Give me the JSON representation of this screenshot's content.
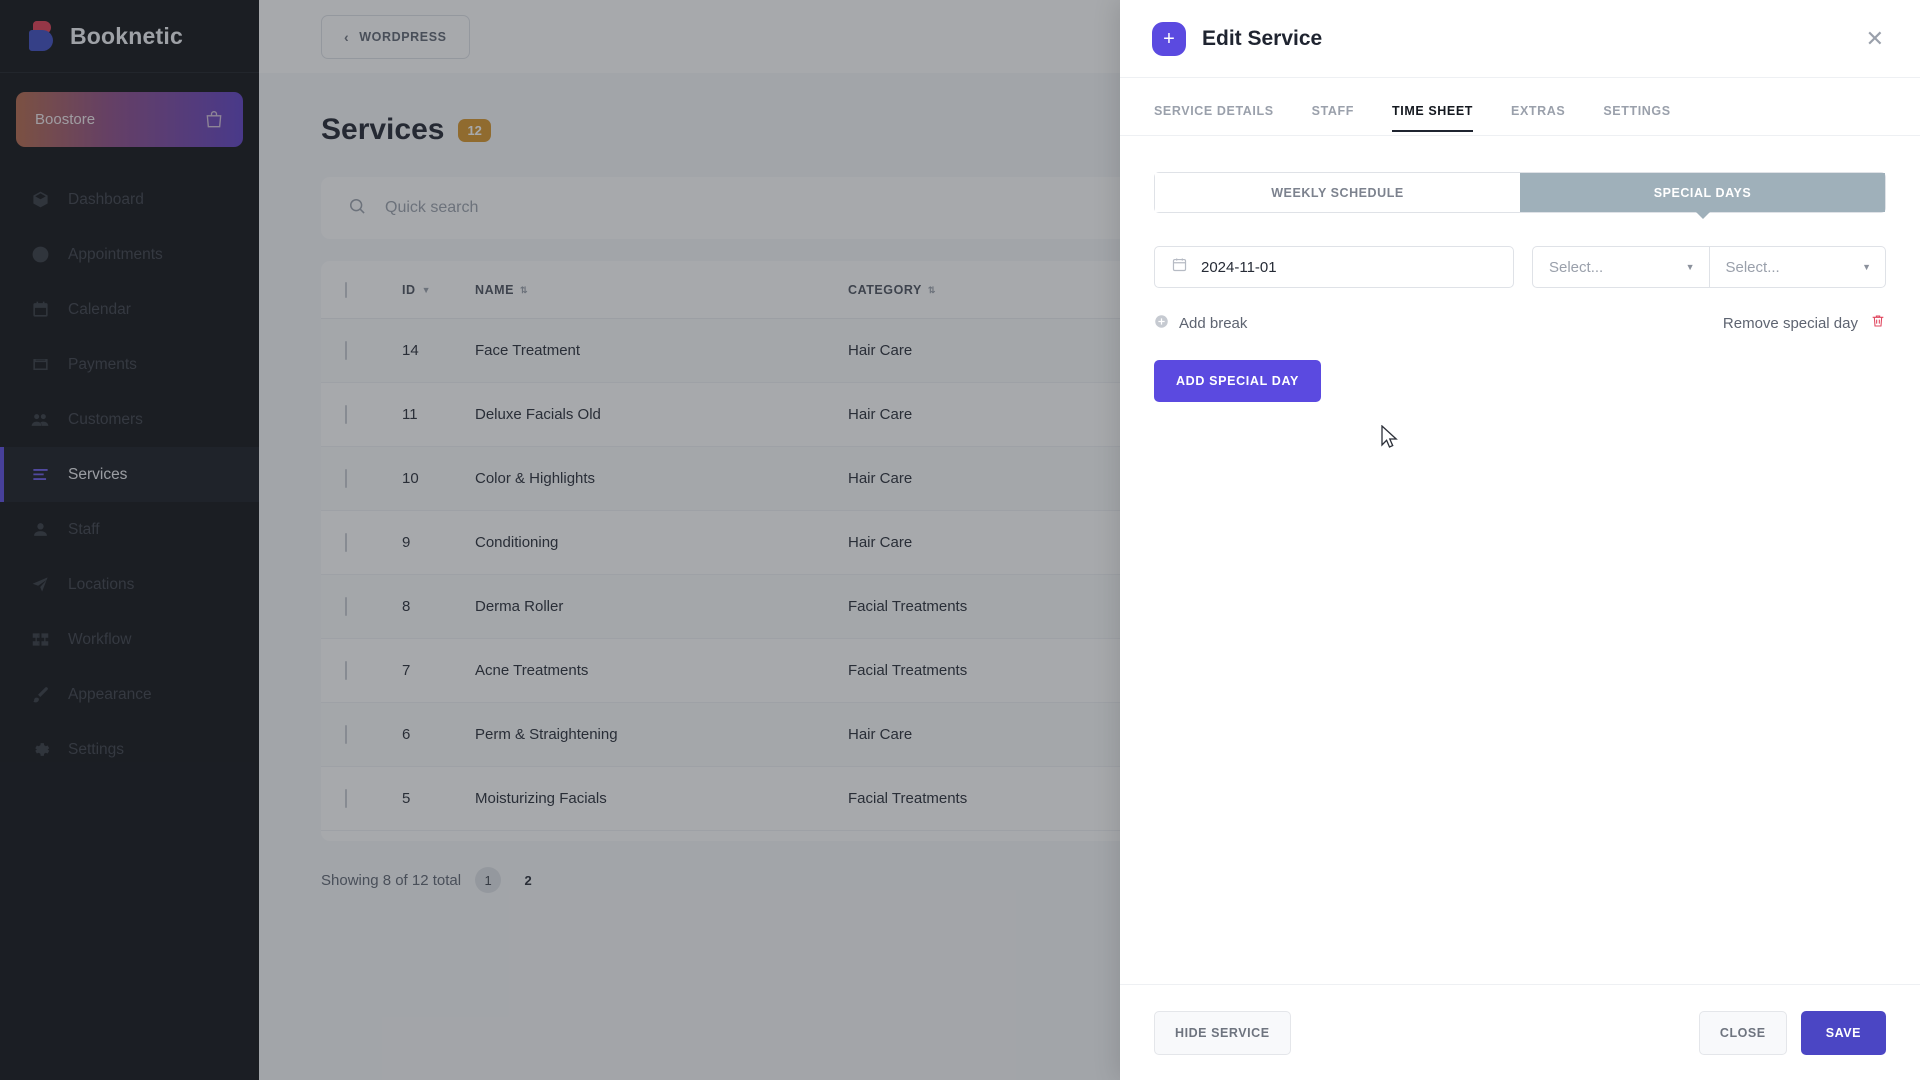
{
  "sidebar": {
    "brand": "Booknetic",
    "store": {
      "name": "Boostore",
      "icon": "shopping-bag-icon"
    },
    "items": [
      {
        "label": "Dashboard",
        "icon": "box-icon",
        "active": false
      },
      {
        "label": "Appointments",
        "icon": "clock-icon",
        "active": false
      },
      {
        "label": "Calendar",
        "icon": "calendar-icon",
        "active": false
      },
      {
        "label": "Payments",
        "icon": "wallet-icon",
        "active": false
      },
      {
        "label": "Customers",
        "icon": "users-icon",
        "active": false
      },
      {
        "label": "Services",
        "icon": "list-icon",
        "active": true
      },
      {
        "label": "Staff",
        "icon": "user-icon",
        "active": false
      },
      {
        "label": "Locations",
        "icon": "send-icon",
        "active": false
      },
      {
        "label": "Workflow",
        "icon": "workflow-icon",
        "active": false
      },
      {
        "label": "Appearance",
        "icon": "brush-icon",
        "active": false
      },
      {
        "label": "Settings",
        "icon": "gear-icon",
        "active": false
      }
    ]
  },
  "topbar": {
    "back_label": "WORDPRESS",
    "back_icon": "chevron-left-icon"
  },
  "page": {
    "title": "Services",
    "count_badge": "12",
    "search_placeholder": "Quick search",
    "search_value": "",
    "search_icon": "search-icon"
  },
  "table": {
    "columns": [
      {
        "label": "ID",
        "sort": "desc"
      },
      {
        "label": "NAME",
        "sort": "both"
      },
      {
        "label": "CATEGORY",
        "sort": "both"
      }
    ],
    "rows": [
      {
        "id": "14",
        "name": "Face Treatment",
        "category": "Hair Care"
      },
      {
        "id": "11",
        "name": "Deluxe Facials Old",
        "category": "Hair Care"
      },
      {
        "id": "10",
        "name": "Color & Highlights",
        "category": "Hair Care"
      },
      {
        "id": "9",
        "name": "Conditioning",
        "category": "Hair Care"
      },
      {
        "id": "8",
        "name": "Derma Roller",
        "category": "Facial Treatments"
      },
      {
        "id": "7",
        "name": "Acne Treatments",
        "category": "Facial Treatments"
      },
      {
        "id": "6",
        "name": "Perm & Straightening",
        "category": "Hair Care"
      },
      {
        "id": "5",
        "name": "Moisturizing Facials",
        "category": "Facial Treatments"
      }
    ]
  },
  "pagination": {
    "showing": "Showing 8 of 12 total",
    "pages": [
      {
        "label": "1",
        "active": true
      },
      {
        "label": "2",
        "active": false
      }
    ]
  },
  "modal": {
    "title": "Edit Service",
    "add_icon": "plus-icon",
    "close_icon": "close-icon",
    "tabs": [
      {
        "label": "SERVICE DETAILS",
        "active": false
      },
      {
        "label": "STAFF",
        "active": false
      },
      {
        "label": "TIME SHEET",
        "active": true
      },
      {
        "label": "EXTRAS",
        "active": false
      },
      {
        "label": "SETTINGS",
        "active": false
      }
    ],
    "segments": [
      {
        "label": "WEEKLY SCHEDULE",
        "active": false
      },
      {
        "label": "SPECIAL DAYS",
        "active": true
      }
    ],
    "special_day": {
      "date_value": "2024-11-01",
      "date_icon": "calendar-icon",
      "select_from": "Select...",
      "select_to": "Select...",
      "caret_icon": "chevron-down-icon"
    },
    "add_break": {
      "label": "Add break",
      "icon": "plus-circle-icon"
    },
    "remove_day": {
      "label": "Remove special day",
      "icon": "trash-icon",
      "icon_color": "#e0465e"
    },
    "add_special_day_label": "ADD SPECIAL DAY",
    "footer": {
      "hide_service_label": "HIDE SERVICE",
      "close_label": "CLOSE",
      "save_label": "SAVE"
    }
  },
  "colors": {
    "accent": "#5b4ae0",
    "badge_orange": "#d79428",
    "segment_active": "#9fb0ba",
    "danger": "#e0465e"
  }
}
